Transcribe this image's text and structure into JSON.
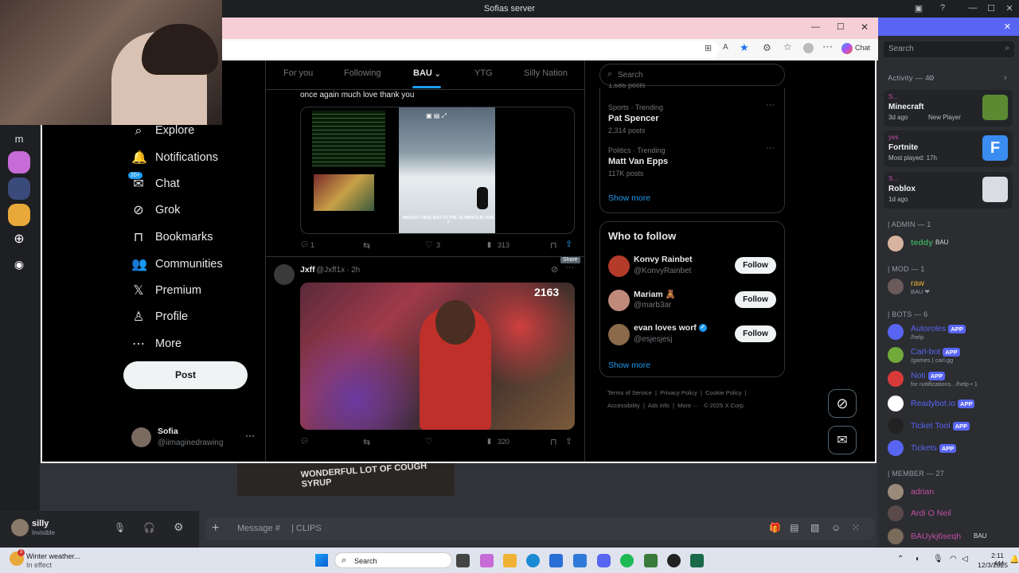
{
  "discord": {
    "window_title": "Sofias server",
    "server_initial": "m",
    "search_placeholder": "Search",
    "activity_header": "Activity — 4",
    "activities": [
      {
        "user": "S...",
        "game": "Minecraft",
        "meta": "3d ago",
        "meta2": "New Player",
        "color": "#5b8a32"
      },
      {
        "user": "yes",
        "game": "Fortnite",
        "meta": "Most played: 17h",
        "meta2": "",
        "color": "#3a8cf0"
      },
      {
        "user": "S...",
        "game": "Roblox",
        "meta": "1d ago",
        "meta2": "",
        "color": "#d9dde3"
      }
    ],
    "admin_header": "| ADMIN — 1",
    "admin": {
      "name": "teddy",
      "tag": "BAU"
    },
    "mod_header": "| MOD — 1",
    "mod": {
      "name": "raw",
      "status": "BAU ❤"
    },
    "bots_header": "| BOTS — 6",
    "bots": [
      {
        "name": "Autoroles",
        "badge": "APP",
        "status": "/help"
      },
      {
        "name": "Carl-bot",
        "badge": "APP",
        "status": "/games | carl.gg"
      },
      {
        "name": "Noti",
        "badge": "APP",
        "status": "for notifications.. /help • 1"
      },
      {
        "name": "Readybot.io",
        "badge": "APP",
        "status": ""
      },
      {
        "name": "Ticket Tool",
        "badge": "APP",
        "status": ""
      },
      {
        "name": "Tickets",
        "badge": "APP",
        "status": ""
      }
    ],
    "member_header": "| MEMBER — 27",
    "members": [
      {
        "name": "adrian",
        "tag": ""
      },
      {
        "name": "Ardi O Neil",
        "tag": ""
      },
      {
        "name": "BAUykj6seqh",
        "tag": "BAU"
      }
    ],
    "user": {
      "name": "silly",
      "status": "Invisible"
    },
    "message_placeholder": "Message #",
    "channel": "| CLIPS"
  },
  "browser": {
    "chat_label": "Chat"
  },
  "twitter": {
    "nav": [
      {
        "icon": "search-icon",
        "glyph": "⌕",
        "label": "Explore"
      },
      {
        "icon": "bell-icon",
        "glyph": "🔔",
        "label": "Notifications"
      },
      {
        "icon": "mail-icon",
        "glyph": "✉",
        "label": "Chat",
        "badge": "20+"
      },
      {
        "icon": "grok-icon",
        "glyph": "⊘",
        "label": "Grok"
      },
      {
        "icon": "bookmark-icon",
        "glyph": "⊓",
        "label": "Bookmarks"
      },
      {
        "icon": "people-icon",
        "glyph": "👥",
        "label": "Communities"
      },
      {
        "icon": "x-logo-icon",
        "glyph": "𝕏",
        "label": "Premium"
      },
      {
        "icon": "person-icon",
        "glyph": "♙",
        "label": "Profile"
      },
      {
        "icon": "more-icon",
        "glyph": "⋯",
        "label": "More"
      }
    ],
    "post_button": "Post",
    "account": {
      "name": "Sofia",
      "handle": "@iimaginedrawing"
    },
    "tabs": [
      "For you",
      "Following",
      "BAU",
      "YTG",
      "Silly Nation"
    ],
    "tweet1": {
      "text": "once again much love thank you",
      "image_caption": "WOULD I TAKE BAU TO THE OLYMPICS IN 2026 ?",
      "replies": "1",
      "retweets": "",
      "likes": "3",
      "views": "313",
      "tooltip": "Share"
    },
    "tweet2": {
      "name": "Jxff",
      "handle": "@Jxff1x",
      "time": "· 2h",
      "overlay_count": "2163",
      "replies": "",
      "retweets": "",
      "likes": "",
      "views": "320"
    },
    "search_placeholder": "Search",
    "trend_prev_posts": "1,585 posts",
    "trends": [
      {
        "category": "Sports · Trending",
        "name": "Pat Spencer",
        "posts": "2,314 posts"
      },
      {
        "category": "Politics · Trending",
        "name": "Matt Van Epps",
        "posts": "117K posts"
      }
    ],
    "show_more": "Show more",
    "who_to_follow": "Who to follow",
    "follow_suggestions": [
      {
        "name": "Konvy Rainbet",
        "handle": "@KonvyRainbet",
        "color": "#b43a2a",
        "verified": false
      },
      {
        "name": "Mariam 🧸",
        "handle": "@marb3ar",
        "color": "#c08a7a",
        "verified": false
      },
      {
        "name": "evan loves worf",
        "handle": "@esjesjesj",
        "color": "#8a6a4a",
        "verified": true
      }
    ],
    "follow_label": "Follow",
    "footer_row1": [
      "Terms of Service",
      "Privacy Policy",
      "Cookie Policy"
    ],
    "footer_row2": [
      "Accessibility",
      "Ads info",
      "More ···",
      "© 2025 X Corp."
    ]
  },
  "taskbar": {
    "weather_title": "Winter weather...",
    "weather_sub": "In effect",
    "weather_badge": "3",
    "search_label": "Search",
    "time": "2:11 AM",
    "date": "12/3/2025"
  },
  "background_clip_text": "WONDERFUL LOT OF COUGH SYRUP"
}
